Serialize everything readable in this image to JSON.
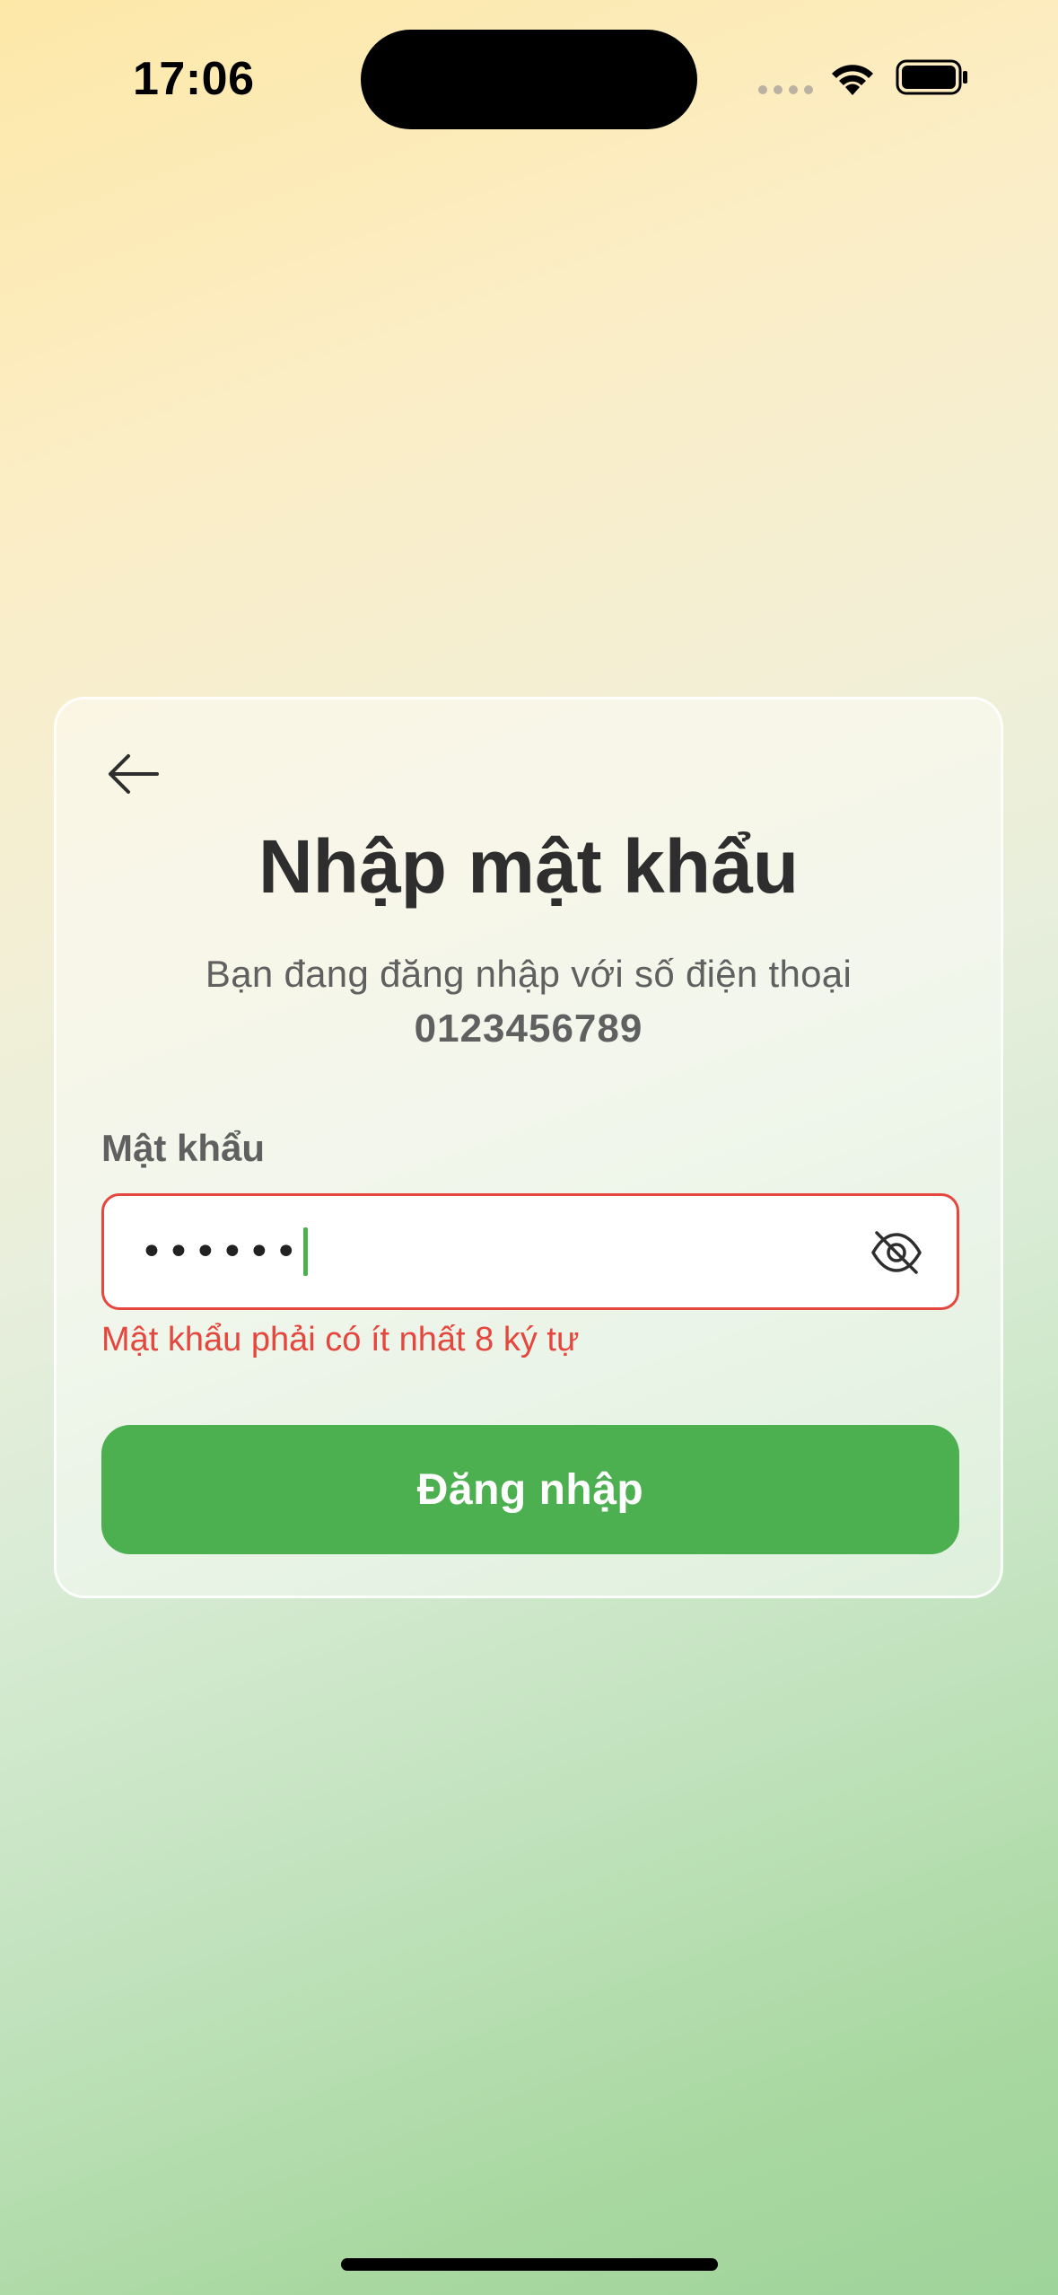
{
  "status_bar": {
    "time": "17:06",
    "icons": [
      "signal-dots-icon",
      "wifi-icon",
      "battery-icon"
    ]
  },
  "card": {
    "back_icon": "arrow-left-icon",
    "title": "Nhập mật khẩu",
    "subtitle": "Bạn đang đăng nhập với số điện thoại",
    "phone_number": "0123456789",
    "password_label": "Mật khẩu",
    "password_value": "••••••",
    "visibility_icon": "eye-off-icon",
    "error_message": "Mật khẩu phải có ít nhất 8 ký tự",
    "login_button_label": "Đăng nhập"
  },
  "colors": {
    "accent_green": "#4caf50",
    "error_red": "#e5463d",
    "title_text": "#2e2e2e",
    "secondary_text": "#606060"
  }
}
